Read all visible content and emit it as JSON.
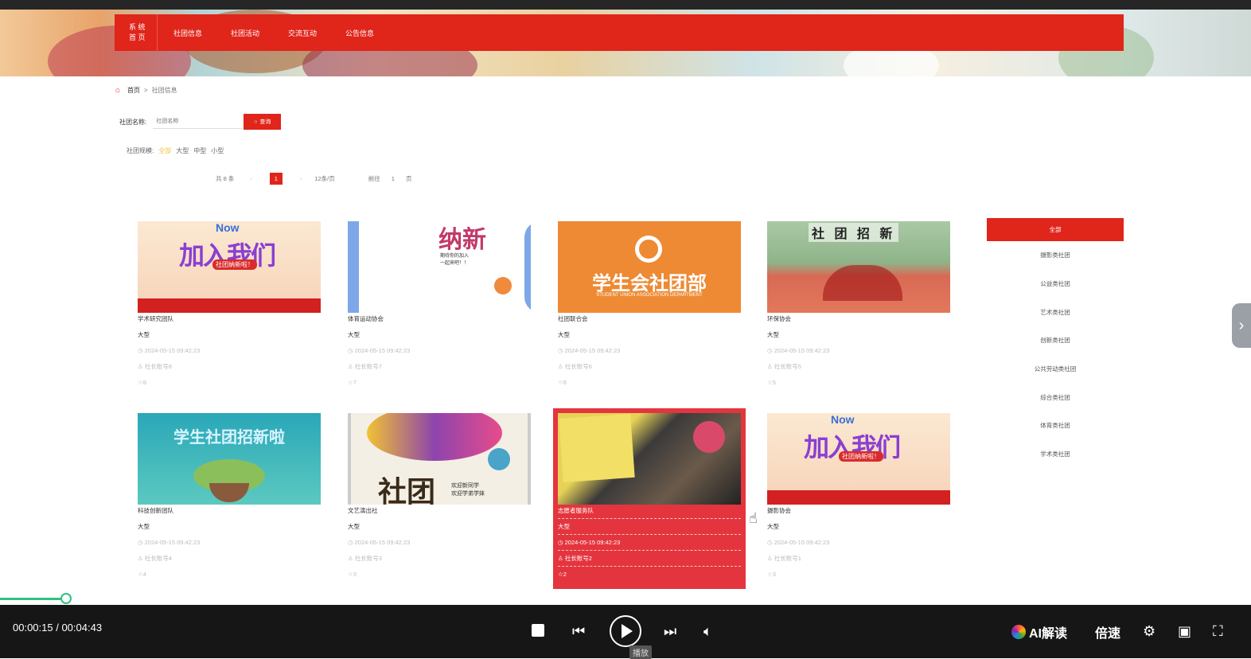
{
  "nav": {
    "home_line1": "系 统",
    "home_line2": "首 页",
    "items": [
      "社团信息",
      "社团活动",
      "交流互动",
      "公告信息"
    ]
  },
  "breadcrumb": {
    "home": "首页",
    "sep": ">",
    "current": "社团信息"
  },
  "search": {
    "label": "社团名称:",
    "placeholder": "社团名称",
    "button": "查询"
  },
  "filter": {
    "label": "社团规模:",
    "options": [
      "全部",
      "大型",
      "中型",
      "小型"
    ]
  },
  "pager": {
    "total": "共 8 条",
    "prev": "‹",
    "page": "1",
    "next": "›",
    "size": "12条/页",
    "goto": "前往",
    "goto_page": "1",
    "page_unit": "页"
  },
  "cards": [
    {
      "name": "学术研究团队",
      "scale": "大型",
      "time": "2024-05-15 09:42:23",
      "account": "社长账号8",
      "stars": "8"
    },
    {
      "name": "体育运动协会",
      "scale": "大型",
      "time": "2024-05-15 09:42:23",
      "account": "社长账号7",
      "stars": "7"
    },
    {
      "name": "社团联合会",
      "scale": "大型",
      "time": "2024-05-15 09:42:23",
      "account": "社长账号6",
      "stars": "6"
    },
    {
      "name": "环保协会",
      "scale": "大型",
      "time": "2024-05-15 09:42:23",
      "account": "社长账号5",
      "stars": "5"
    },
    {
      "name": "科技创新团队",
      "scale": "大型",
      "time": "2024-05-15 09:42:23",
      "account": "社长账号4",
      "stars": "4"
    },
    {
      "name": "文艺演出社",
      "scale": "大型",
      "time": "2024-05-15 09:42:23",
      "account": "社长账号3",
      "stars": "3"
    },
    {
      "name": "志愿者服务队",
      "scale": "大型",
      "time": "2024-05-15 09:42:23",
      "account": "社长账号2",
      "stars": "2"
    },
    {
      "name": "摄影协会",
      "scale": "大型",
      "time": "2024-05-15 09:42:23",
      "account": "社长账号1",
      "stars": "3"
    }
  ],
  "poster_texts": {
    "p1_now": "Now",
    "p1_main": "加入我们",
    "p1_sub": "社团纳新啦！",
    "p2_title": "纳新",
    "p2_line": "期待你的加入\n一起来吧！！",
    "p3_main": "学生会社团部",
    "p3_sub": "STUDENT UNION ASSOCIATION DEPARTMENT",
    "p4_title": "社 团 招 新",
    "p5_main": "学生社团招新啦",
    "p6_main": "社团",
    "p6_sub": "欢迎新同学\n欢迎学弟学妹"
  },
  "sidebar": {
    "active": "全部",
    "items": [
      "摄影类社团",
      "公益类社团",
      "艺术类社团",
      "创新类社团",
      "公共劳动类社团",
      "综合类社团",
      "体育类社团",
      "学术类社团"
    ]
  },
  "player": {
    "time": "00:00:15 / 00:04:43",
    "progress": 0.053,
    "ai_label": "AI解读",
    "speed_label": "倍速",
    "tooltip": "播放"
  },
  "colors": {
    "accent": "#e0251b",
    "highlight_card": "#e4353e",
    "progress": "#2ec27e",
    "filter_active": "#f0c33c"
  }
}
